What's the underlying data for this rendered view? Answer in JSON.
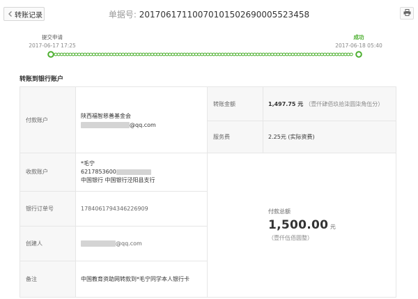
{
  "header": {
    "back_label": "转账记录",
    "order_label": "单据号:",
    "order_number": "20170617110070101502690005523458",
    "print_icon": "printer-icon"
  },
  "progress": {
    "start": {
      "title": "提交申请",
      "time": "2017-06-17 17:25"
    },
    "end": {
      "title": "成功",
      "time": "2017-06-18 05:40"
    },
    "color": "#4caf2f"
  },
  "section_title": "转账到银行账户",
  "payer": {
    "label": "付款账户",
    "name": "陕西福智慈善基金会",
    "email_suffix": "@qq.com"
  },
  "amount": {
    "label": "转账金额",
    "value": "1,497.75 元",
    "uppercase": "（壹仟肆佰玖拾柒圆柒角伍分）"
  },
  "fee": {
    "label": "服务费",
    "value": "2.25元 (实际资费)"
  },
  "payee": {
    "label": "收款账户",
    "name": "*毛宁",
    "card_prefix": "6217853600",
    "bank": "中国银行 中国银行泾阳县支行"
  },
  "bank_order": {
    "label": "银行订单号",
    "value": "1784061794346226909"
  },
  "total": {
    "label": "付款总额",
    "value": "1,500.00",
    "unit": "元",
    "uppercase": "（壹仟伍佰圆整）"
  },
  "creator": {
    "label": "创建人",
    "email_suffix": "@qq.com"
  },
  "note": {
    "label": "备注",
    "value": "中国教育资助网转款到*毛宁同学本人银行卡"
  }
}
